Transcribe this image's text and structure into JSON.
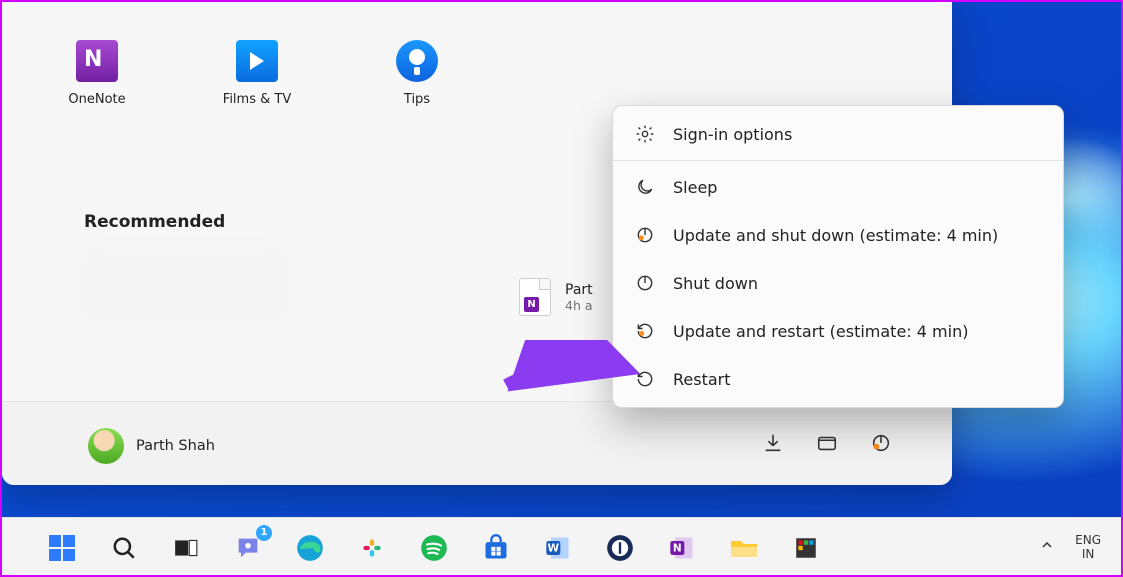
{
  "pinned": [
    {
      "id": "onenote",
      "label": "OneNote"
    },
    {
      "id": "films",
      "label": "Films & TV"
    },
    {
      "id": "tips",
      "label": "Tips"
    }
  ],
  "recommended": {
    "heading": "Recommended",
    "item2": {
      "title": "Part",
      "subtitle": "4h a"
    }
  },
  "footer": {
    "user_name": "Parth Shah"
  },
  "power_menu": {
    "signin": "Sign-in options",
    "sleep": "Sleep",
    "update_shut": "Update and shut down (estimate: 4 min)",
    "shutdown": "Shut down",
    "update_rest": "Update and restart (estimate: 4 min)",
    "restart": "Restart"
  },
  "taskbar": {
    "lang_top": "ENG",
    "lang_bot": "IN",
    "chat_badge": "1"
  }
}
